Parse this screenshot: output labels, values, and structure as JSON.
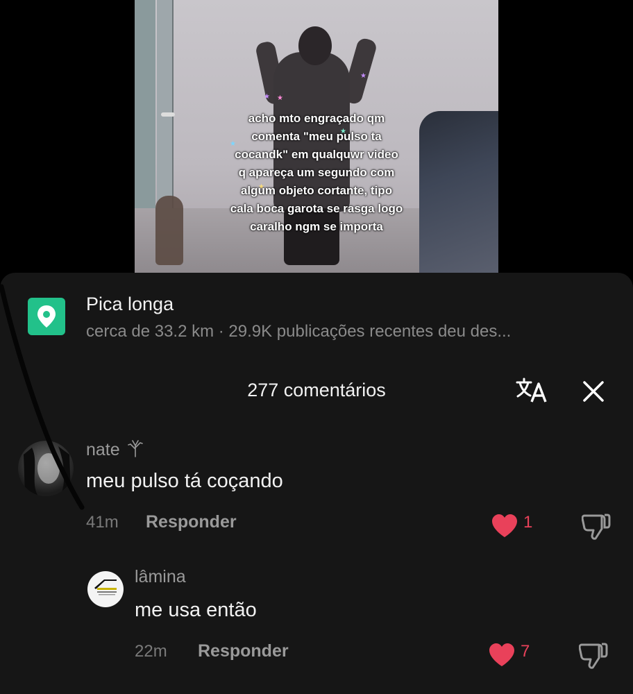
{
  "video": {
    "overlay_text": "acho mto engraçado qm\ncomenta \"meu pulso ta\ncocandk\" em qualquwr video\nq apareça um segundo com\nalgum objeto cortante, tipo\ncala boca garota se rasga logo\ncaralho ngm se importa"
  },
  "location": {
    "icon": "location-pin-icon",
    "title": "Pica longa",
    "subtitle": "cerca de 33.2 km · 29.9K publicações recentes deu des..."
  },
  "comments_header": {
    "count_label": "277 comentários",
    "translate_icon": "translate-icon",
    "close_icon": "close-icon"
  },
  "comments": [
    {
      "username": "nate",
      "badge_icon": "tree-icon",
      "text": "meu pulso tá coçando",
      "time": "41m",
      "reply_label": "Responder",
      "likes": "1",
      "liked": true
    },
    {
      "username": "lâmina",
      "text": "me usa então",
      "time": "22m",
      "reply_label": "Responder",
      "likes": "7",
      "liked": true
    }
  ],
  "colors": {
    "sheet_bg": "#161616",
    "location_green": "#22c18a",
    "like_red": "#e9415a"
  }
}
